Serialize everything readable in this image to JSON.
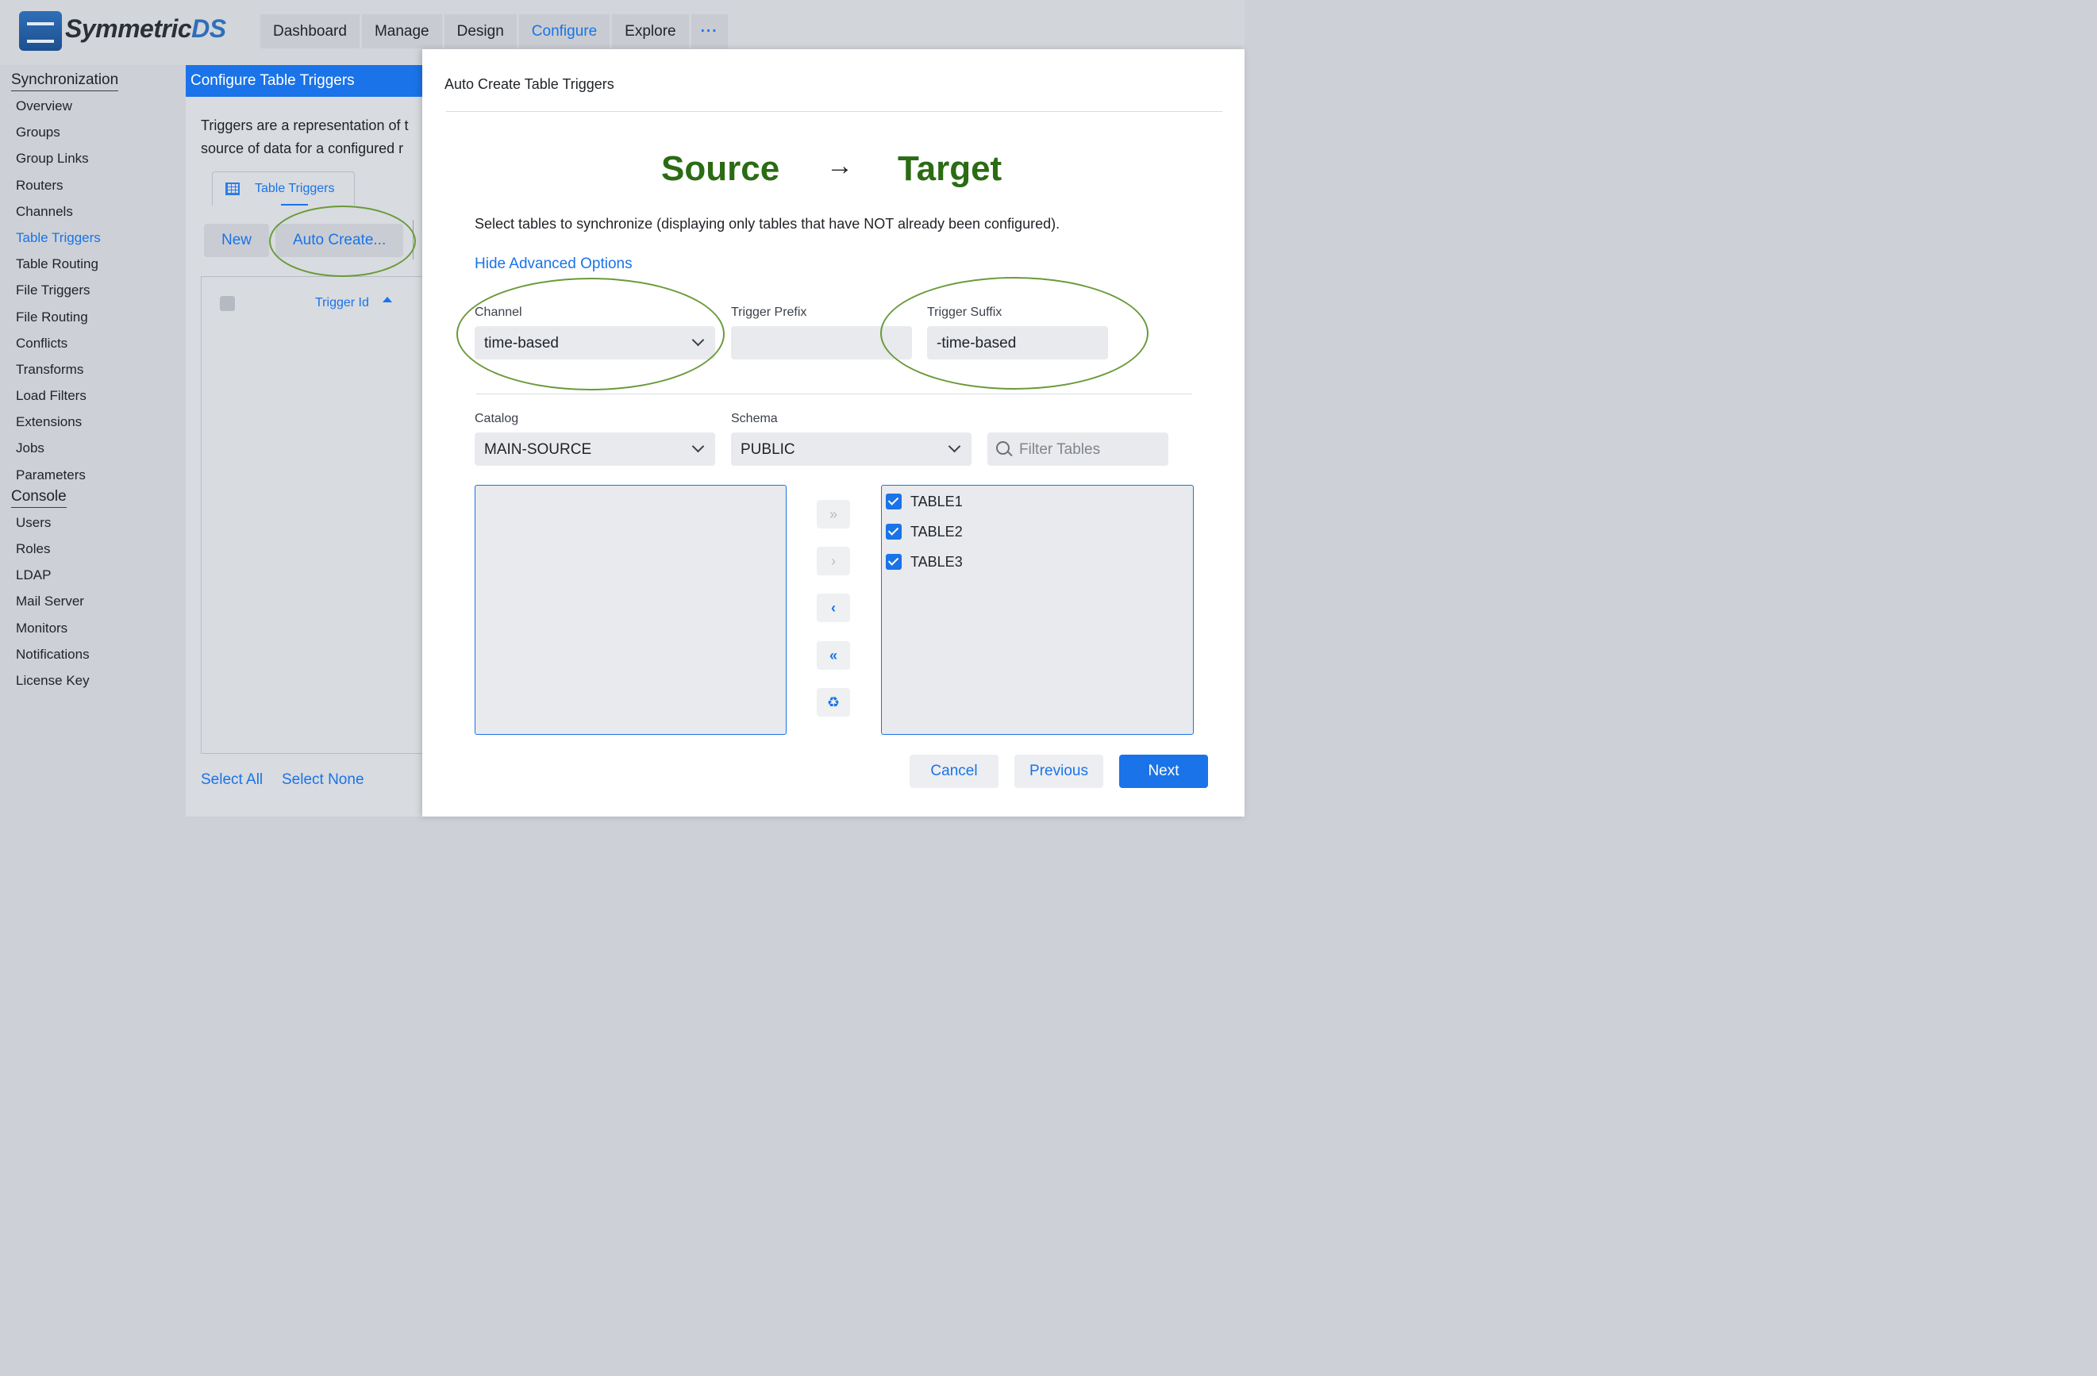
{
  "app": {
    "logo_text_a": "Symmetric",
    "logo_text_b": "DS"
  },
  "nav": {
    "items": [
      "Dashboard",
      "Manage",
      "Design",
      "Configure",
      "Explore"
    ],
    "active": "Configure",
    "more_label": "···"
  },
  "sidebar": {
    "sync_section": "Synchronization",
    "sync_items": [
      "Overview",
      "Groups",
      "Group Links",
      "Routers",
      "Channels",
      "Table Triggers",
      "Table Routing",
      "File Triggers",
      "File Routing",
      "Conflicts",
      "Transforms",
      "Load Filters",
      "Extensions",
      "Jobs",
      "Parameters"
    ],
    "active_item": "Table Triggers",
    "console_section": "Console",
    "console_items": [
      "Users",
      "Roles",
      "LDAP",
      "Mail Server",
      "Monitors",
      "Notifications",
      "License Key"
    ]
  },
  "content": {
    "title": "Configure Table Triggers",
    "desc_line1": "Triggers are a representation of t",
    "desc_line2": "source of data for a configured r",
    "tab_label": "Table Triggers",
    "new_button": "New",
    "auto_create_button": "Auto Create...",
    "grid_column": "Trigger Id",
    "select_all": "Select All",
    "select_none": "Select None"
  },
  "dialog": {
    "title": "Auto Create Table Triggers",
    "source": "Source",
    "arrow": "→",
    "target": "Target",
    "instructions": "Select tables to synchronize (displaying only tables that have NOT already been configured).",
    "advanced_link": "Hide Advanced Options",
    "channel_label": "Channel",
    "channel_value": "time-based",
    "prefix_label": "Trigger Prefix",
    "prefix_value": "",
    "suffix_label": "Trigger Suffix",
    "suffix_value": "-time-based",
    "catalog_label": "Catalog",
    "catalog_value": "MAIN-SOURCE",
    "schema_label": "Schema",
    "schema_value": "PUBLIC",
    "filter_placeholder": "Filter Tables",
    "selected_tables": [
      "TABLE1",
      "TABLE2",
      "TABLE3"
    ],
    "move_buttons": [
      "»",
      "›",
      "‹",
      "«",
      "♻"
    ],
    "cancel": "Cancel",
    "previous": "Previous",
    "next": "Next"
  },
  "colors": {
    "accent": "#1a73e8",
    "hero_green": "#2a6b14",
    "highlight_ellipse": "#6a9a3a"
  }
}
